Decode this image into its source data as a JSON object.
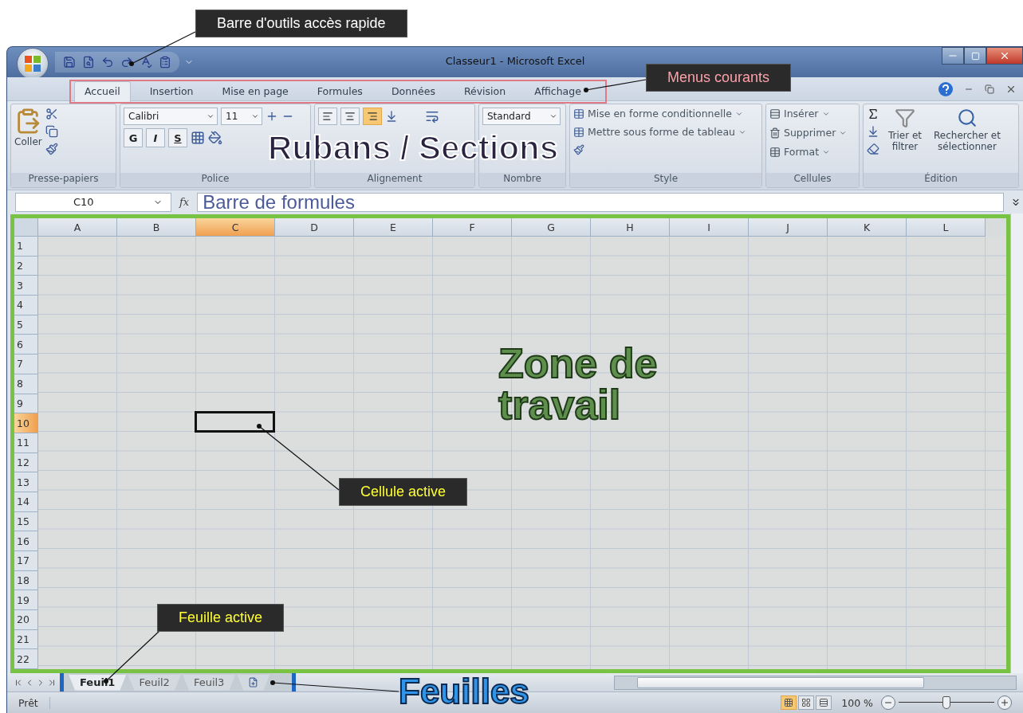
{
  "callouts": [
    {
      "text": "Barre d'outils accès rapide"
    },
    {
      "text": "Menus courants"
    },
    {
      "text": "Cellule active"
    },
    {
      "text": "Feuille active"
    }
  ],
  "overlays": [
    {
      "text": "Rubans / Sections"
    },
    {
      "text": "Zone de travail"
    },
    {
      "text": "Feuilles"
    }
  ],
  "window": {
    "title": "Classeur1 - Microsoft Excel"
  },
  "tabs": [
    {
      "label": "Accueil",
      "selected": true
    },
    {
      "label": "Insertion",
      "selected": false
    },
    {
      "label": "Mise en page",
      "selected": false
    },
    {
      "label": "Formules",
      "selected": false
    },
    {
      "label": "Données",
      "selected": false
    },
    {
      "label": "Révision",
      "selected": false
    },
    {
      "label": "Affichage",
      "selected": false
    }
  ],
  "ribbon": {
    "clipboard": {
      "paste": "Coller",
      "label": "Presse-papiers"
    },
    "font": {
      "name": "Calibri",
      "size": "11",
      "styles": [
        "G",
        "I",
        "S"
      ],
      "label": "Police"
    },
    "alignment": {
      "buttons": [
        {
          "kind": "top",
          "selected": false
        },
        {
          "kind": "middle",
          "selected": false
        },
        {
          "kind": "bottom",
          "selected": true
        }
      ],
      "label": "Alignement"
    },
    "number": {
      "format": "Standard",
      "label": "Nombre"
    },
    "style": {
      "items": [
        "Mise en forme conditionnelle",
        "Mettre sous forme de tableau"
      ],
      "label": "Style"
    },
    "cells": {
      "items": [
        "Insérer",
        "Supprimer",
        "Format"
      ],
      "label": "Cellules"
    },
    "editing": {
      "sort": "Trier et filtrer",
      "find": "Rechercher et sélectionner",
      "label": "Édition"
    }
  },
  "formula_bar": {
    "name_box": "C10",
    "function_label": "fx",
    "annotation": "Barre de formules"
  },
  "sheet": {
    "columns": [
      {
        "label": "A",
        "selected": false
      },
      {
        "label": "B",
        "selected": false
      },
      {
        "label": "C",
        "selected": true
      },
      {
        "label": "D",
        "selected": false
      },
      {
        "label": "E",
        "selected": false
      },
      {
        "label": "F",
        "selected": false
      },
      {
        "label": "G",
        "selected": false
      },
      {
        "label": "H",
        "selected": false
      },
      {
        "label": "I",
        "selected": false
      },
      {
        "label": "J",
        "selected": false
      },
      {
        "label": "K",
        "selected": false
      },
      {
        "label": "L",
        "selected": false
      }
    ],
    "rows": [
      {
        "label": "1",
        "selected": false
      },
      {
        "label": "2",
        "selected": false
      },
      {
        "label": "3",
        "selected": false
      },
      {
        "label": "4",
        "selected": false
      },
      {
        "label": "5",
        "selected": false
      },
      {
        "label": "6",
        "selected": false
      },
      {
        "label": "7",
        "selected": false
      },
      {
        "label": "8",
        "selected": false
      },
      {
        "label": "9",
        "selected": false
      },
      {
        "label": "10",
        "selected": true
      },
      {
        "label": "11",
        "selected": false
      },
      {
        "label": "12",
        "selected": false
      },
      {
        "label": "13",
        "selected": false
      },
      {
        "label": "14",
        "selected": false
      },
      {
        "label": "15",
        "selected": false
      },
      {
        "label": "16",
        "selected": false
      },
      {
        "label": "17",
        "selected": false
      },
      {
        "label": "18",
        "selected": false
      },
      {
        "label": "19",
        "selected": false
      },
      {
        "label": "20",
        "selected": false
      },
      {
        "label": "21",
        "selected": false
      },
      {
        "label": "22",
        "selected": false
      }
    ]
  },
  "sheet_tabs": [
    {
      "label": "Feuil1",
      "selected": true
    },
    {
      "label": "Feuil2",
      "selected": false
    },
    {
      "label": "Feuil3",
      "selected": false
    }
  ],
  "status_bar": {
    "status": "Prêt",
    "views": [
      {
        "kind": "normal",
        "selected": true
      },
      {
        "kind": "layout",
        "selected": false
      },
      {
        "kind": "breaks",
        "selected": false
      }
    ],
    "zoom": "100 %",
    "level": 0.5
  }
}
